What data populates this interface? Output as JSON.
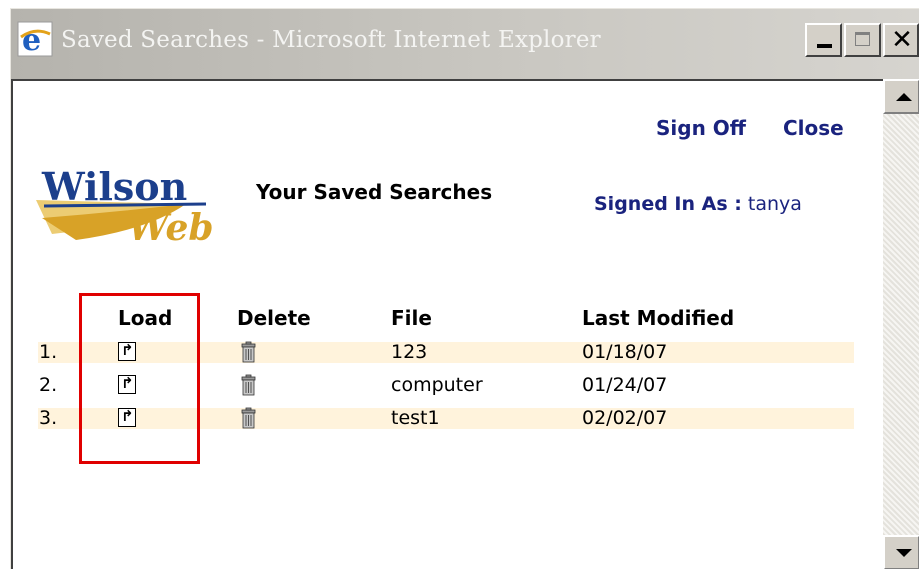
{
  "window": {
    "title": "Saved Searches - Microsoft Internet Explorer",
    "icon": "ie-icon",
    "controls": [
      "minimize-icon",
      "maximize-icon",
      "close-icon"
    ]
  },
  "header": {
    "sign_off": "Sign Off",
    "close": "Close",
    "logo_text_top": "Wilson",
    "logo_text_bottom": "Web",
    "heading": "Your Saved Searches",
    "signed_in_label": "Signed In As :",
    "signed_in_user": "tanya"
  },
  "table": {
    "columns": {
      "load": "Load",
      "delete": "Delete",
      "file": "File",
      "last_modified": "Last Modified"
    },
    "rows": [
      {
        "num": "1.",
        "file": "123",
        "modified": "01/18/07"
      },
      {
        "num": "2.",
        "file": "computer",
        "modified": "01/24/07"
      },
      {
        "num": "3.",
        "file": "test1",
        "modified": "02/02/07"
      }
    ],
    "load_icon": "upload-arrow-icon",
    "delete_icon": "trash-can-icon"
  },
  "colors": {
    "link": "#1a237e",
    "row_shade": "#fff3dc",
    "highlight": "#e00000",
    "logo_blue": "#1c3f8c",
    "logo_gold": "#d8a227"
  }
}
